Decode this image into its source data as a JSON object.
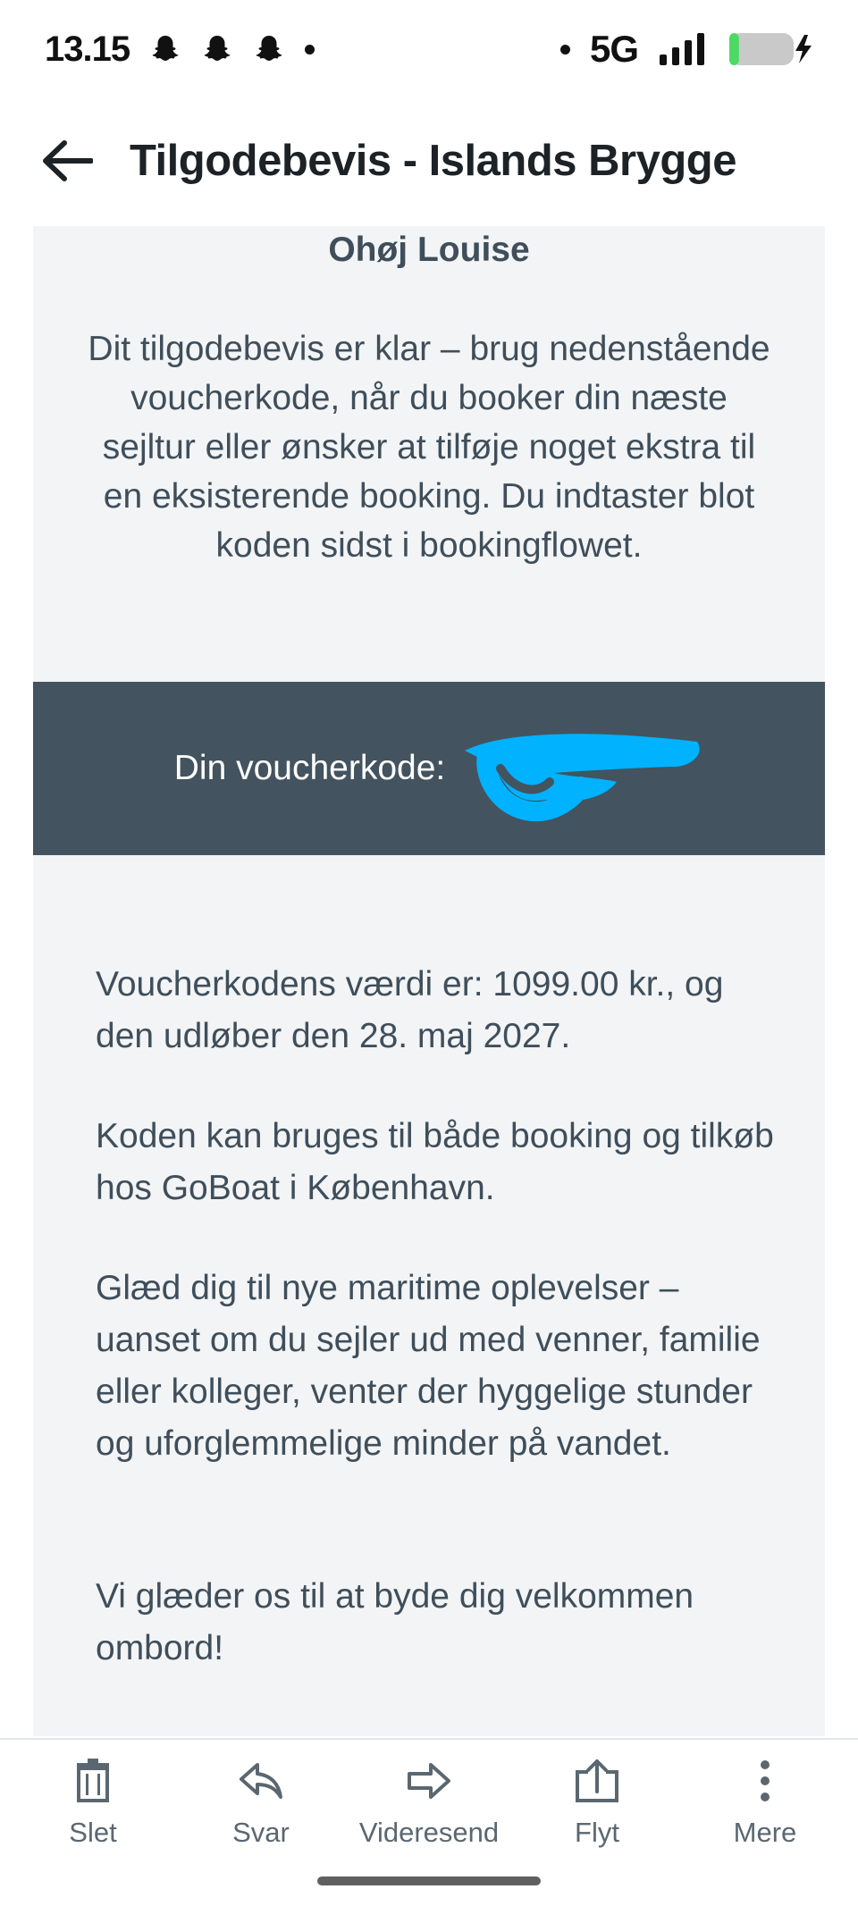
{
  "status_bar": {
    "time": "13.15",
    "network": "5G",
    "notification_icons": [
      "snapchat-icon",
      "snapchat-icon",
      "snapchat-icon"
    ],
    "battery_level_fraction": 0.15,
    "battery_state": "charging"
  },
  "header": {
    "title": "Tilgodebevis - Islands Brygge"
  },
  "email": {
    "greeting": "Ohøj Louise",
    "intro": "Dit tilgodebevis er klar – brug nedenstående voucherkode, når du booker din næste sejltur eller ønsker at tilføje noget ekstra til en eksisterende booking. Du indtaster blot koden sidst i bookingflowet.",
    "voucher_label": "Din voucherkode:",
    "paragraph_value": "Voucherkodens værdi er: 1099.00 kr., og den udløber den 28. maj 2027.",
    "paragraph_usage": "Koden kan bruges til både booking og tilkøb hos GoBoat i København.",
    "paragraph_enjoy": "Glæd dig til nye maritime oplevelser – uanset om du sejler ud med venner, familie eller kolleger, venter der hyggelige stunder og uforglemmelige minder på vandet.",
    "paragraph_welcome": "Vi glæder os til at byde dig velkommen ombord!"
  },
  "colors": {
    "voucher_band": "#43535f",
    "card_background": "#f2f4f6",
    "body_text": "#3f4e5a",
    "redaction": "#00b2ff"
  },
  "toolbar": {
    "items": [
      {
        "label": "Slet",
        "icon": "trash-icon"
      },
      {
        "label": "Svar",
        "icon": "reply-icon"
      },
      {
        "label": "Videresend",
        "icon": "forward-icon"
      },
      {
        "label": "Flyt",
        "icon": "move-icon"
      },
      {
        "label": "Mere",
        "icon": "more-vertical-icon"
      }
    ]
  }
}
